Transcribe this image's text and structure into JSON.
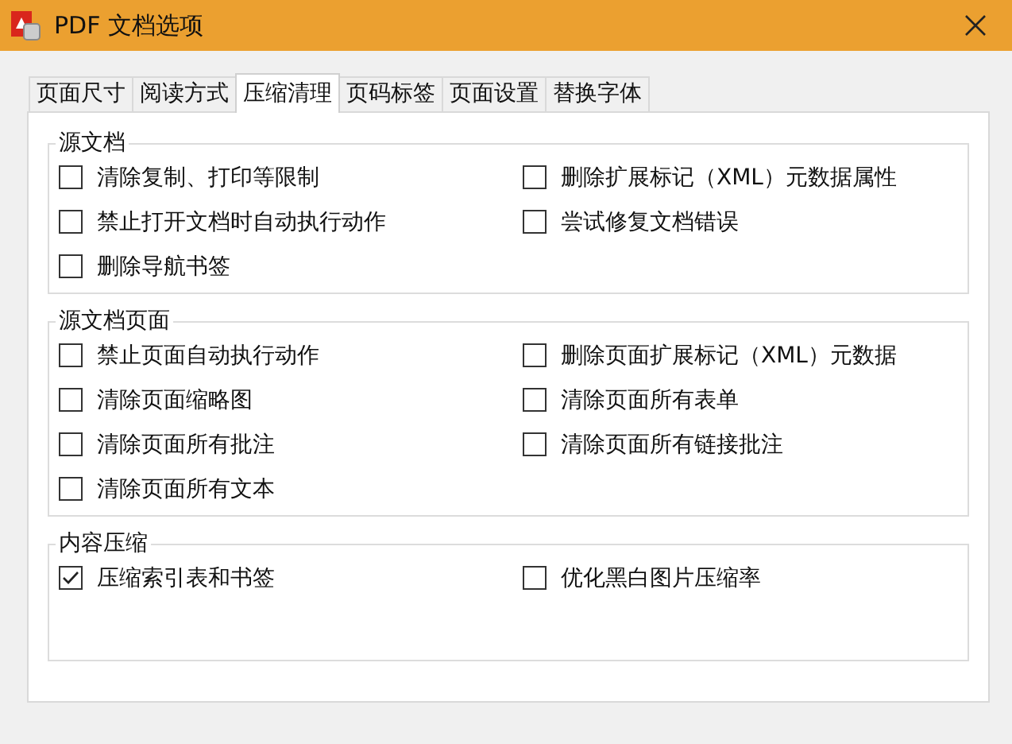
{
  "window": {
    "title": "PDF 文档选项"
  },
  "tabs": [
    {
      "label": "页面尺寸",
      "selected": false
    },
    {
      "label": "阅读方式",
      "selected": false
    },
    {
      "label": "压缩清理",
      "selected": true
    },
    {
      "label": "页码标签",
      "selected": false
    },
    {
      "label": "页面设置",
      "selected": false
    },
    {
      "label": "替换字体",
      "selected": false
    }
  ],
  "groups": [
    {
      "title": "源文档",
      "options": [
        {
          "label": "清除复制、打印等限制",
          "checked": false
        },
        {
          "label": "删除扩展标记（XML）元数据属性",
          "checked": false
        },
        {
          "label": "禁止打开文档时自动执行动作",
          "checked": false
        },
        {
          "label": "尝试修复文档错误",
          "checked": false
        },
        {
          "label": "删除导航书签",
          "checked": false
        }
      ]
    },
    {
      "title": "源文档页面",
      "options": [
        {
          "label": "禁止页面自动执行动作",
          "checked": false
        },
        {
          "label": "删除页面扩展标记（XML）元数据",
          "checked": false
        },
        {
          "label": "清除页面缩略图",
          "checked": false
        },
        {
          "label": "清除页面所有表单",
          "checked": false
        },
        {
          "label": "清除页面所有批注",
          "checked": false
        },
        {
          "label": "清除页面所有链接批注",
          "checked": false
        },
        {
          "label": "清除页面所有文本",
          "checked": false
        }
      ]
    },
    {
      "title": "内容压缩",
      "options": [
        {
          "label": "压缩索引表和书签",
          "checked": true
        },
        {
          "label": "优化黑白图片压缩率",
          "checked": false
        }
      ]
    }
  ]
}
